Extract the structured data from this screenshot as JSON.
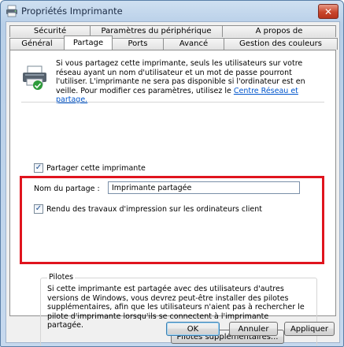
{
  "window": {
    "title": "Propriétés Imprimante",
    "close_symbol": "✕",
    "icon": "printer-icon"
  },
  "tabs": {
    "top_row": [
      "Sécurité",
      "Paramètres du périphérique",
      "A propos de"
    ],
    "bottom_row": [
      "Général",
      "Partage",
      "Ports",
      "Avancé",
      "Gestion des couleurs"
    ],
    "active": "Partage"
  },
  "info": {
    "text": "Si vous partagez cette imprimante, seuls les utilisateurs sur votre réseau ayant un nom d'utilisateur et un mot de passe pourront l'utiliser. L'imprimante ne sera pas disponible si l'ordinateur est en veille. Pour modifier ces paramètres, utilisez le ",
    "link": "Centre Réseau et partage."
  },
  "share": {
    "checkbox_label": "Partager cette imprimante",
    "checked": true,
    "name_label": "Nom du partage :",
    "name_value": "Imprimante partagée",
    "render_label": "Rendu des travaux d'impression sur les ordinateurs client",
    "render_checked": true
  },
  "drivers": {
    "title": "Pilotes",
    "text": "Si cette imprimante est partagée avec des utilisateurs d'autres versions de Windows, vous devrez peut-être installer des pilotes supplémentaires, afin que les utilisateurs n'aient pas à rechercher le pilote d'imprimante lorsqu'ils se connectent à l'imprimante partagée.",
    "button": "Pilotes supplémentaires..."
  },
  "footer": {
    "ok": "OK",
    "cancel": "Annuler",
    "apply": "Appliquer"
  },
  "colors": {
    "highlight": "#e0141e",
    "link": "#0055cc"
  }
}
